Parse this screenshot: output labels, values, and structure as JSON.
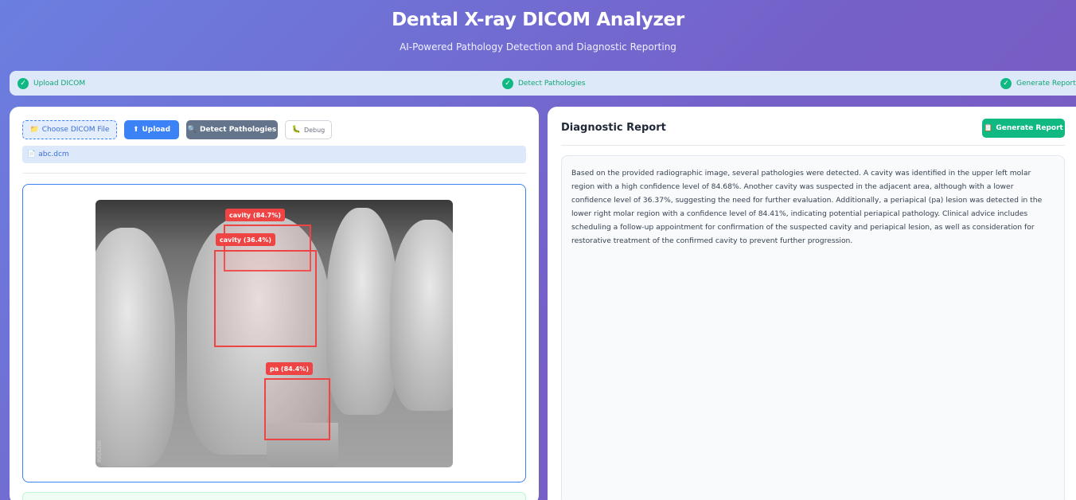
{
  "header": {
    "title": "Dental X-ray DICOM Analyzer",
    "subtitle": "AI-Powered Pathology Detection and Diagnostic Reporting"
  },
  "steps": [
    {
      "label": "Upload DICOM",
      "status": "complete"
    },
    {
      "label": "Detect Pathologies",
      "status": "complete"
    },
    {
      "label": "Generate Report",
      "status": "complete"
    }
  ],
  "toolbar": {
    "choose_label": "Choose DICOM File",
    "choose_icon": "folder-icon",
    "upload_label": "Upload",
    "upload_icon": "upload-icon",
    "detect_label": "Detect Pathologies",
    "detect_icon": "magnifier-icon",
    "debug_label": "Debug",
    "debug_icon": "bug-icon"
  },
  "file": {
    "name": "abc.dcm",
    "icon": "document-icon"
  },
  "viewer": {
    "image_watermark": "RVG6200",
    "detections": [
      {
        "label": "cavity (84.7%)",
        "class": "cavity",
        "confidence": 84.7
      },
      {
        "label": "cavity (36.4%)",
        "class": "cavity",
        "confidence": 36.4
      },
      {
        "label": "pa (84.4%)",
        "class": "pa",
        "confidence": 84.4
      }
    ]
  },
  "report": {
    "title": "Diagnostic Report",
    "generate_label": "Generate Report",
    "generate_icon": "clipboard-icon",
    "text": "Based on the provided radiographic image, several pathologies were detected. A cavity was identified in the upper left molar region with a high confidence level of 84.68%. Another cavity was suspected in the adjacent area, although with a lower confidence level of 36.37%, suggesting the need for further evaluation. Additionally, a periapical (pa) lesion was detected in the lower right molar region with a confidence level of 84.41%, indicating potential periapical pathology. Clinical advice includes scheduling a follow-up appointment for confirmation of the suspected cavity and periapical lesion, as well as consideration for restorative treatment of the confirmed cavity to prevent further progression."
  },
  "colors": {
    "primary": "#3b82f6",
    "success": "#10b981",
    "danger": "#ef4444",
    "secondary": "#64748b"
  }
}
